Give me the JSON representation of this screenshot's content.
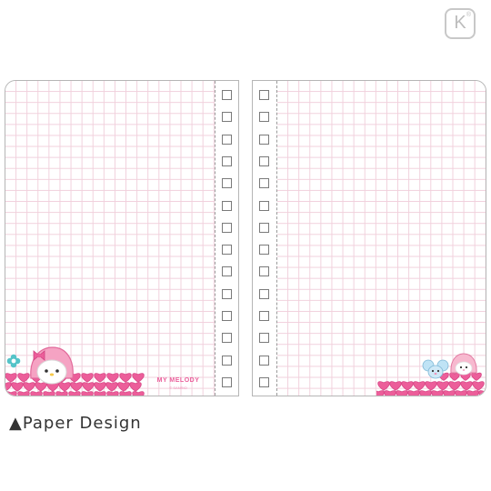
{
  "store_logo": {
    "letter": "K",
    "mark": "®"
  },
  "left_page": {
    "brand_name": "MY MELODY",
    "brand_copyright": "© SANRIO",
    "holes_count": 14
  },
  "right_page": {
    "holes_count": 14
  },
  "caption": {
    "symbol": "▲",
    "text": "Paper Design"
  },
  "colors": {
    "grid_line": "#f1d0dc",
    "heart_pink": "#ec5e9a",
    "brand_pink": "#ea5f9b"
  }
}
